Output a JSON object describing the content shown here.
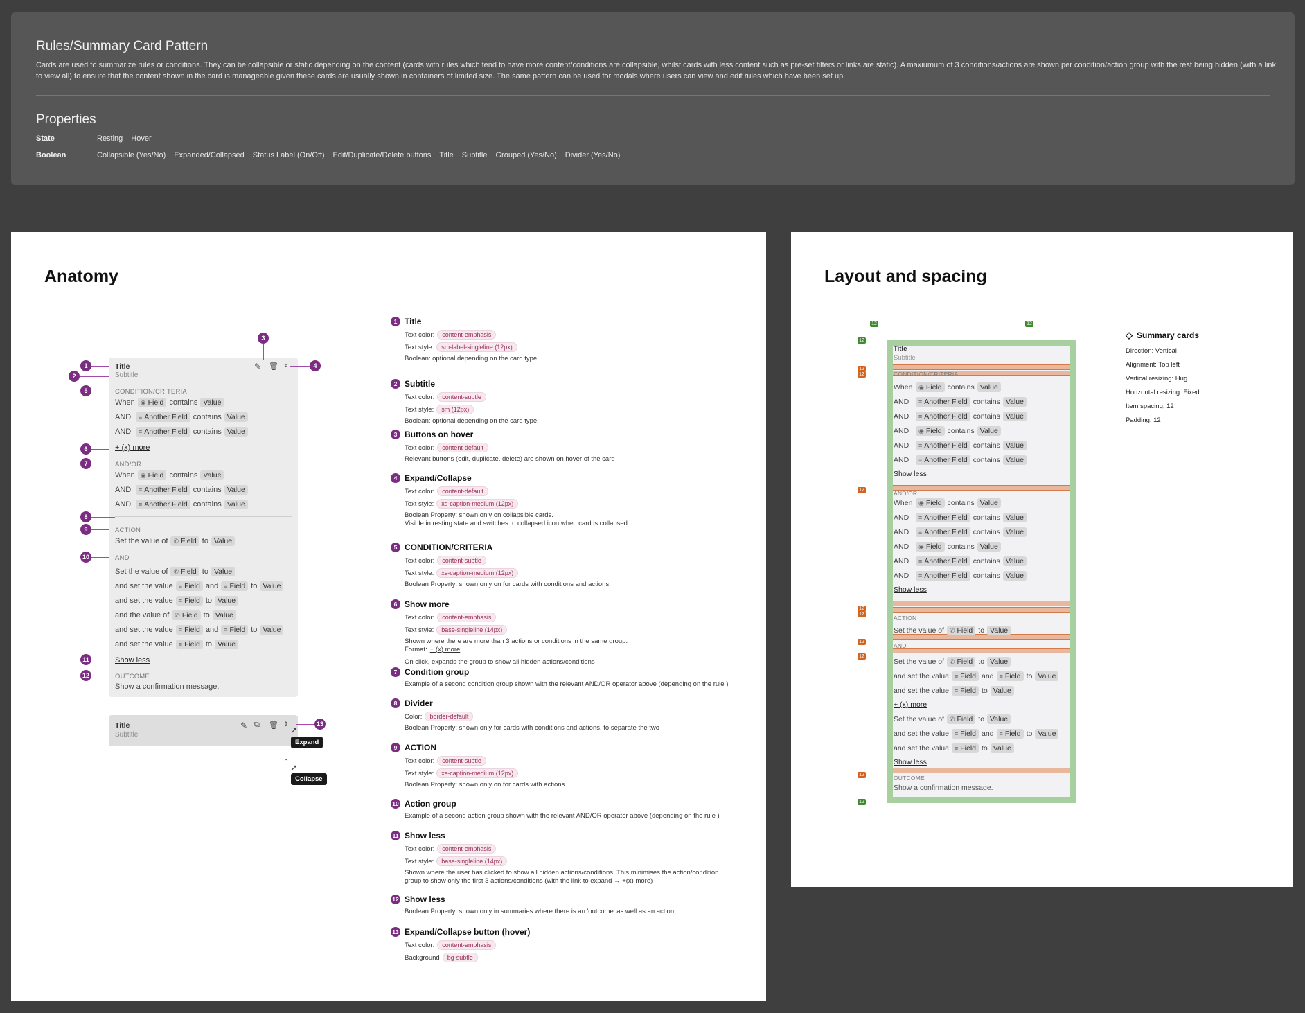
{
  "header": {
    "title": "Rules/Summary Card Pattern",
    "description": "Cards are used to summarize rules or conditions. They can be collapsible or static depending on the content (cards with rules which tend to have more content/conditions are collapsible, whilst cards with less content such as pre-set filters or links are static). A maxiumum of 3 conditions/actions are shown per condition/action group with the rest being hidden (with a link to view all) to ensure that the content shown in the card is manageable given these cards are usually shown in containers of limited size. The same pattern can be used for modals where users can view and edit rules which have been set up.",
    "properties_title": "Properties",
    "state_label": "State",
    "state_values": [
      "Resting",
      "Hover"
    ],
    "boolean_label": "Boolean",
    "boolean_values": [
      "Collapsible (Yes/No)",
      "Expanded/Collapsed",
      "Status Label (On/Off)",
      "Edit/Duplicate/Delete buttons",
      "Title",
      "Subtitle",
      "Grouped (Yes/No)",
      "Divider (Yes/No)"
    ]
  },
  "anatomy": {
    "title": "Anatomy",
    "card": {
      "title": "Title",
      "subtitle": "Subtitle",
      "cond_cap": "CONDITION/CRITERIA",
      "andor_cap": "AND/OR",
      "action_cap": "ACTION",
      "and_cap": "AND",
      "outcome_cap": "OUTCOME",
      "outcome_text": "Show a confirmation message.",
      "show_more": "+ (x) more",
      "show_less": "Show less",
      "w": "When",
      "and": "AND",
      "contains": "contains",
      "field": "Field",
      "another": "Another Field",
      "value": "Value",
      "setv": "Set the value of",
      "to": "to",
      "andset": "and set the value",
      "andv": "and the value of",
      "and_lc": "and"
    },
    "collapsed": {
      "title": "Title",
      "subtitle": "Subtitle",
      "expand": "Expand",
      "collapse": "Collapse"
    },
    "markers": [
      "1",
      "2",
      "3",
      "4",
      "5",
      "6",
      "7",
      "8",
      "9",
      "10",
      "11",
      "12",
      "13"
    ],
    "desc": [
      {
        "n": "1",
        "h": "Title",
        "l": [
          [
            "Text color:",
            "content-emphasis"
          ],
          [
            "Text style:",
            "sm-label-singleline (12px)"
          ],
          [
            "Boolean: optional depending on the card type",
            ""
          ]
        ]
      },
      {
        "n": "2",
        "h": "Subtitle",
        "l": [
          [
            "Text color:",
            "content-subtle"
          ],
          [
            "Text style:",
            "sm (12px)"
          ],
          [
            "Boolean: optional depending on the card type",
            ""
          ]
        ]
      },
      {
        "n": "3",
        "h": "Buttons on hover",
        "l": [
          [
            "Text color:",
            "content-default"
          ],
          [
            "Relevant buttons (edit, duplicate, delete) are shown on hover of the card",
            ""
          ]
        ]
      },
      {
        "n": "4",
        "h": "Expand/Collapse",
        "l": [
          [
            "Text color:",
            "content-default"
          ],
          [
            "Text style:",
            "xs-caption-medium (12px)"
          ],
          [
            "Boolean Property: shown only on collapsible cards.",
            ""
          ],
          [
            "Visible in resting state and switches to collapsed icon when card is collapsed",
            ""
          ]
        ]
      },
      {
        "n": "5",
        "h": "CONDITION/CRITERIA",
        "l": [
          [
            "Text color:",
            "content-subtle"
          ],
          [
            "Text style:",
            "xs-caption-medium (12px)"
          ],
          [
            "Boolean Property: shown only on for cards with conditions and actions",
            ""
          ]
        ]
      },
      {
        "n": "6",
        "h": "Show more",
        "l": [
          [
            "Text color:",
            "content-emphasis"
          ],
          [
            "Text style:",
            "base-singleline (14px)"
          ],
          [
            "Shown where there are more than 3 actions or conditions in the same group.",
            ""
          ],
          [
            "Format:",
            "+ (x) more"
          ],
          [
            "On click, expands the group to show all hidden actions/conditions",
            ""
          ]
        ]
      },
      {
        "n": "7",
        "h": "Condition group",
        "l": [
          [
            "Example of a second condition group shown with the relevant AND/OR operator above (depending on the rule )",
            ""
          ]
        ]
      },
      {
        "n": "8",
        "h": "Divider",
        "l": [
          [
            "Color:",
            "border-default"
          ],
          [
            "Boolean Property: shown only for cards with conditions and actions, to separate the two",
            ""
          ]
        ]
      },
      {
        "n": "9",
        "h": "ACTION",
        "l": [
          [
            "Text color:",
            "content-subtle"
          ],
          [
            "Text style:",
            "xs-caption-medium (12px)"
          ],
          [
            "Boolean Property: shown only on for cards with actions",
            ""
          ]
        ]
      },
      {
        "n": "10",
        "h": "Action group",
        "l": [
          [
            "Example of a second action group shown with the relevant AND/OR operator above (depending on the rule )",
            ""
          ]
        ]
      },
      {
        "n": "11",
        "h": "Show less",
        "l": [
          [
            "Text color:",
            "content-emphasis"
          ],
          [
            "Text style:",
            "base-singleline (14px)"
          ],
          [
            "Shown where the user has clicked to show all hidden actions/conditions. This minimises the action/condition",
            ""
          ],
          [
            "group to show only the first 3 actions/conditions (with the link to expand → +(x) more)",
            ""
          ]
        ]
      },
      {
        "n": "12",
        "h": "Show less",
        "l": [
          [
            "Boolean Property: shown only in summaries where there is an 'outcome' as well as an action.",
            ""
          ]
        ]
      },
      {
        "n": "13",
        "h": "Expand/Collapse button (hover)",
        "l": [
          [
            "Text color:",
            "content-emphasis"
          ],
          [
            "Background",
            "bg-subtle"
          ]
        ]
      }
    ]
  },
  "layout": {
    "title": "Layout and spacing",
    "spec_title": "Summary cards",
    "spec": [
      "Direction: Vertical",
      "Alignment: Top left",
      "Vertical resizing: Hug",
      "Horizontal resizing: Fixed",
      "Item spacing: 12",
      "Padding: 12"
    ],
    "badge": "12"
  },
  "colors": {
    "accent": "#7b2d82",
    "token_bg": "#f6e8ee",
    "spacing_orange": "#d2641e",
    "padding_green": "#3f8a2f"
  }
}
